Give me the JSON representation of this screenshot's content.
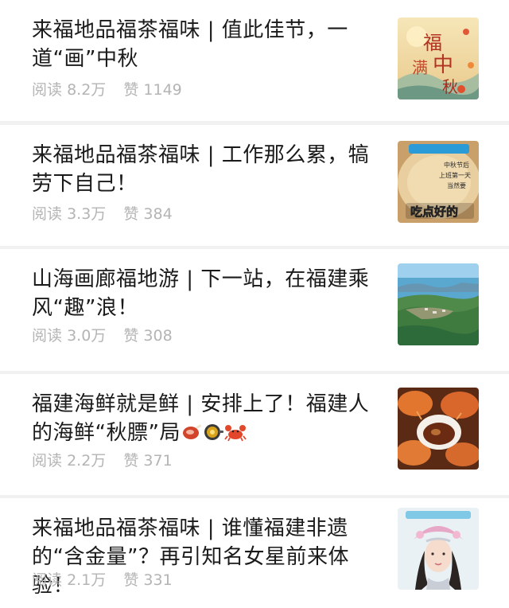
{
  "articles": [
    {
      "title": "来福地品福茶福味 | 值此佳节，一道“画”中秋",
      "read_label": "阅读",
      "read_count": "8.2万",
      "like_label": "赞",
      "like_count": "1149",
      "thumb_icon": "mid-autumn-fu-poster",
      "thumb_text": [
        "福",
        "满",
        "中",
        "秋"
      ]
    },
    {
      "title": "来福地品福茶福味 | 工作那么累，犒劳下自己！",
      "read_label": "阅读",
      "read_count": "3.3万",
      "like_label": "赞",
      "like_count": "384",
      "thumb_icon": "porridge-bowl-image",
      "thumb_text": [
        "中秋节后",
        "上班第一天",
        "当然要",
        "吃点好的"
      ]
    },
    {
      "title": "山海画廊福地游 | 下一站，在福建乘风“趣”浪！",
      "read_label": "阅读",
      "read_count": "3.0万",
      "like_label": "赞",
      "like_count": "308",
      "thumb_icon": "island-coast-aerial-image",
      "thumb_text": []
    },
    {
      "title": "福建海鲜就是鲜 | 安排上了！福建人的海鲜“秋膘”局",
      "read_label": "阅读",
      "read_count": "2.2万",
      "like_label": "赞",
      "like_count": "371",
      "thumb_icon": "hairy-crab-dish-image",
      "thumb_text": []
    },
    {
      "title": "来福地品福茶福味 | 谁懂福建非遗的“含金量”？再引知名女星前来体验！",
      "read_label": "阅读",
      "read_count": "2.1万",
      "like_label": "赞",
      "like_count": "331",
      "thumb_icon": "woman-silver-headdress-image",
      "thumb_text": []
    }
  ],
  "emoji_icons": [
    "meat-emoji-icon",
    "frying-pan-emoji-icon",
    "crab-emoji-icon"
  ],
  "colors": {
    "background": "#f1f1f1",
    "card": "#ffffff",
    "title": "#1a1a1a",
    "meta": "#b4b4b4"
  }
}
